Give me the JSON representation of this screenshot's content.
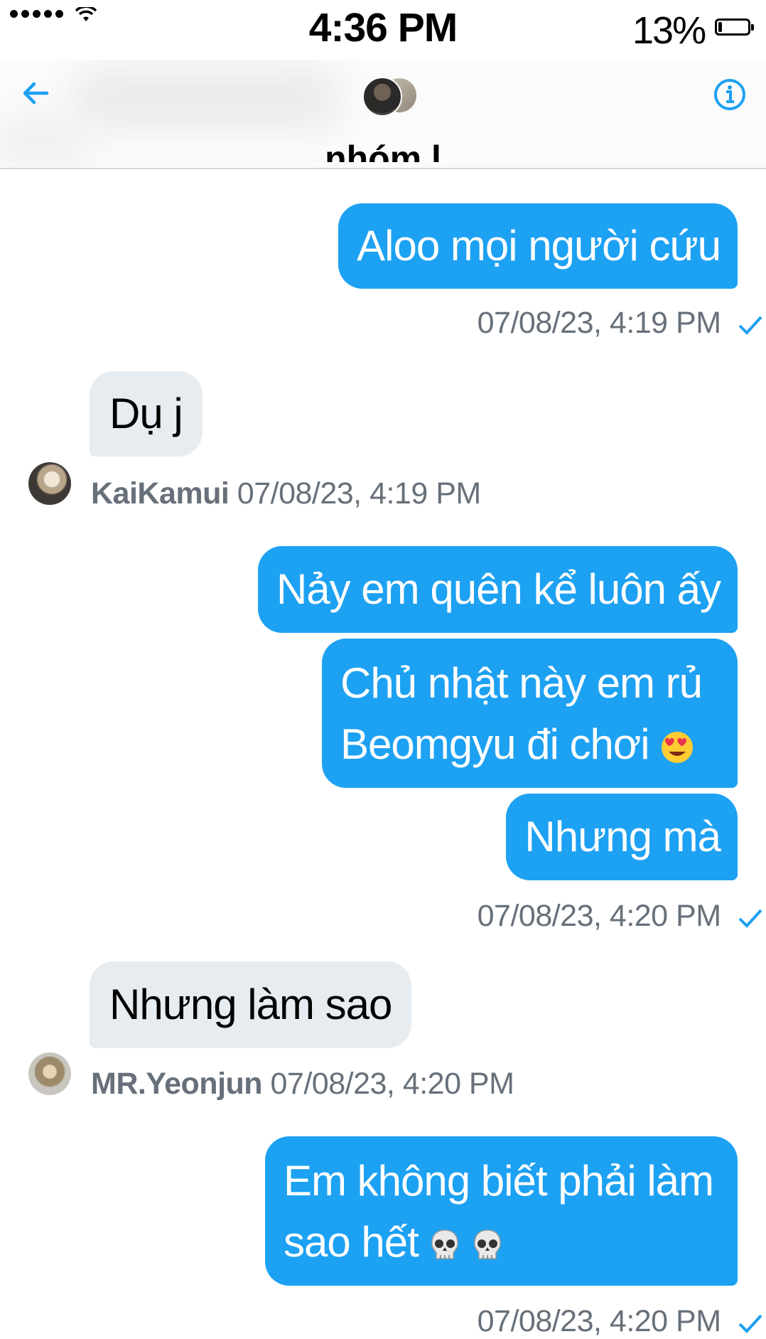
{
  "status_bar": {
    "time": "4:36 PM",
    "battery_percent": "13%",
    "battery_level": 0.13
  },
  "header": {
    "title": "nhóm l",
    "back_icon": "arrow-left-icon",
    "info_icon": "info-icon"
  },
  "messages": [
    {
      "direction": "outgoing",
      "text": "Aloo mọi người cứu"
    },
    {
      "direction": "outgoing_meta",
      "timestamp": "07/08/23, 4:19 PM",
      "status_icon": "checkmark-icon"
    },
    {
      "direction": "incoming",
      "text": "Dụ j",
      "sender": "KaiKamui",
      "timestamp": "07/08/23, 4:19 PM"
    },
    {
      "direction": "outgoing",
      "text": "Nảy em quên kể luôn ấy"
    },
    {
      "direction": "outgoing",
      "text_line1": "Chủ nhật này em rủ",
      "text_line2": "Beomgyu đi chơi",
      "emoji": "heart-eyes-emoji"
    },
    {
      "direction": "outgoing",
      "text": "Nhưng mà"
    },
    {
      "direction": "outgoing_meta",
      "timestamp": "07/08/23, 4:20 PM",
      "status_icon": "checkmark-icon"
    },
    {
      "direction": "incoming",
      "text": "Nhưng làm sao",
      "sender": "MR.Yeonjun",
      "timestamp": "07/08/23, 4:20 PM"
    },
    {
      "direction": "outgoing",
      "text_line1": "Em không biết phải làm",
      "text_line2": "sao hết",
      "emoji": "skull-emoji"
    },
    {
      "direction": "outgoing_meta",
      "timestamp": "07/08/23, 4:20 PM",
      "status_icon": "checkmark-icon"
    }
  ],
  "colors": {
    "outgoing_bubble": "#1da1f2",
    "incoming_bubble": "#e6ecf0",
    "accent": "#1da1f2",
    "meta_text": "#67707a"
  }
}
